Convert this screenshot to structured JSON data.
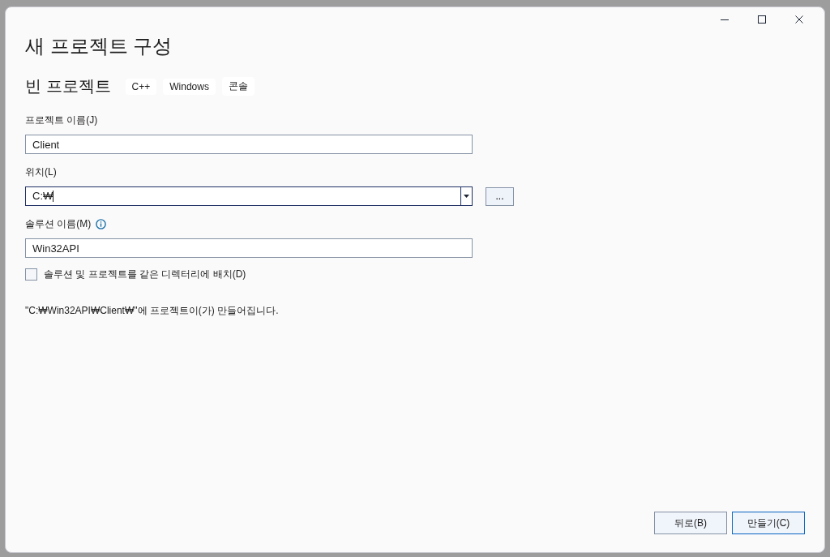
{
  "window": {
    "controls": [
      {
        "kind": "minimize"
      },
      {
        "kind": "maximize"
      },
      {
        "kind": "close"
      }
    ]
  },
  "title": "새 프로젝트 구성",
  "template": {
    "name": "빈 프로젝트",
    "tags": [
      "C++",
      "Windows",
      "콘솔"
    ]
  },
  "fields": [
    {
      "kind": "text",
      "label": "프로젝트 이름(J)",
      "value": "Client",
      "info": false
    },
    {
      "kind": "combo",
      "label": "위치(L)",
      "value": "C:₩",
      "info": false,
      "focused": true,
      "browse": "..."
    },
    {
      "kind": "text",
      "label": "솔루션 이름(M)",
      "value": "Win32API",
      "info": true
    }
  ],
  "checkbox": {
    "label": "솔루션 및 프로젝트를 같은 디렉터리에 배치(D)",
    "checked": false
  },
  "summary": "\"C:₩Win32API₩Client₩\"에 프로젝트이(가) 만들어집니다.",
  "buttons": [
    {
      "label": "뒤로(B)",
      "default": false
    },
    {
      "label": "만들기(C)",
      "default": true
    }
  ]
}
